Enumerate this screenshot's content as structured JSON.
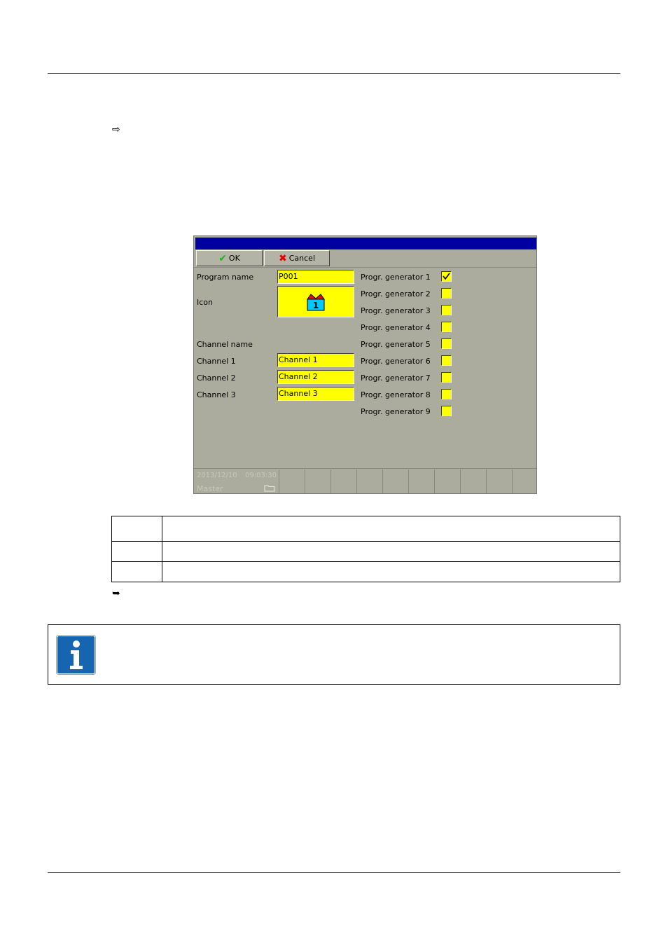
{
  "document": {
    "arrow_step": "⇨",
    "arrow_result": "➥"
  },
  "screen": {
    "toolbar": {
      "ok_label": "OK",
      "cancel_label": "Cancel"
    },
    "program_name_label": "Program name",
    "program_name_value": "P001",
    "icon_label": "Icon",
    "icon_number": "1",
    "channel_name_label": "Channel name",
    "channels": [
      {
        "label": "Channel 1",
        "value": "Channel 1"
      },
      {
        "label": "Channel 2",
        "value": "Channel 2"
      },
      {
        "label": "Channel 3",
        "value": "Channel 3"
      }
    ],
    "generators": [
      {
        "label": "Progr. generator 1",
        "checked": true
      },
      {
        "label": "Progr. generator 2",
        "checked": false
      },
      {
        "label": "Progr. generator 3",
        "checked": false
      },
      {
        "label": "Progr. generator 4",
        "checked": false
      },
      {
        "label": "Progr. generator 5",
        "checked": false
      },
      {
        "label": "Progr. generator 6",
        "checked": false
      },
      {
        "label": "Progr. generator 7",
        "checked": false
      },
      {
        "label": "Progr. generator 8",
        "checked": false
      },
      {
        "label": "Progr. generator 9",
        "checked": false
      }
    ],
    "status": {
      "date": "2013/12/10",
      "time": "09:03:30",
      "user": "Master"
    },
    "colors": {
      "titlebar": "#0000a0",
      "field": "#ffff00",
      "background": "#acac9e"
    }
  },
  "table": {
    "rows": [
      [
        "",
        ""
      ],
      [
        "",
        ""
      ],
      [
        "",
        ""
      ]
    ]
  },
  "note": {
    "icon": "info-icon",
    "color": "#1565b0"
  }
}
